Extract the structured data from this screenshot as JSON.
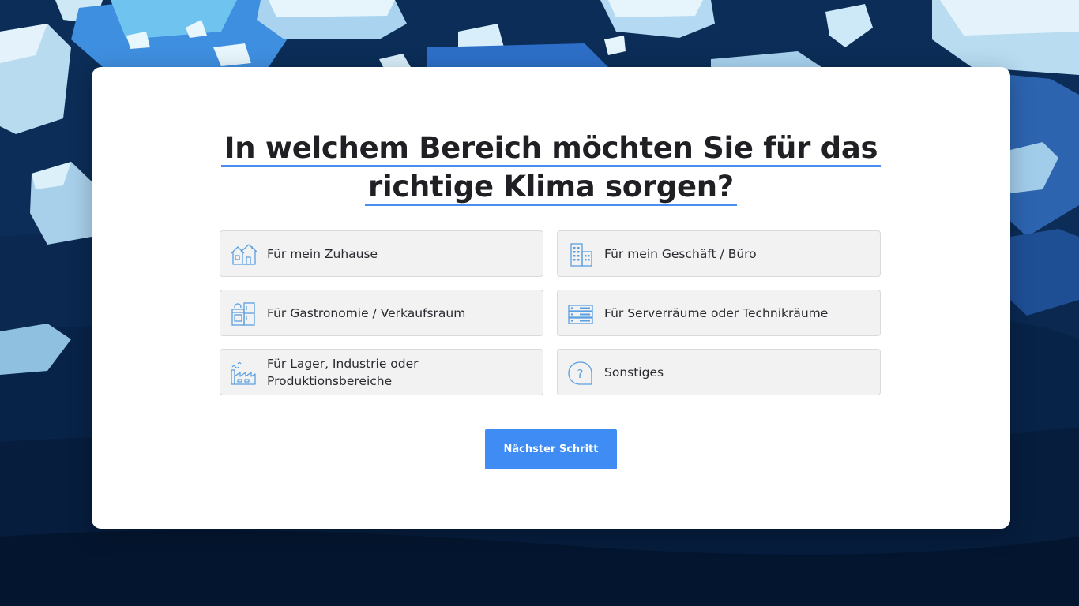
{
  "question": {
    "line1": "In welchem Bereich möchten Sie für das",
    "line2": "richtige Klima sorgen?"
  },
  "options": [
    {
      "label": "Für mein Zuhause",
      "icon": "house-icon"
    },
    {
      "label": "Für mein Geschäft / Büro",
      "icon": "office-building-icon"
    },
    {
      "label": "Für Gastronomie / Verkaufsraum",
      "icon": "kitchen-appliance-icon"
    },
    {
      "label": "Für Serverräume oder Technikräume",
      "icon": "server-rack-icon"
    },
    {
      "label": "Für Lager, Industrie oder Produktionsbereiche",
      "icon": "factory-icon"
    },
    {
      "label": "Sonstiges",
      "icon": "question-bubble-icon"
    }
  ],
  "next_button": {
    "label": "Nächster Schritt"
  },
  "colors": {
    "accent": "#3f8cf5",
    "underline": "#4a8ff0",
    "icon": "#5a9fe0",
    "background": "#0a2a50"
  }
}
